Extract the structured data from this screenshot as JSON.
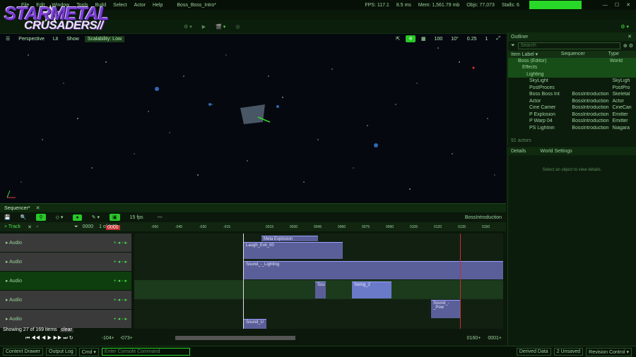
{
  "menubar": {
    "items": [
      "File",
      "Edit",
      "Window",
      "Tools",
      "Build",
      "Select",
      "Actor",
      "Help"
    ],
    "tab": "Boss_Boss_Intro*"
  },
  "logo": {
    "line1": "STARMETAL",
    "line2": "CRUSADERS//"
  },
  "stats": {
    "fps": "FPS: 117.1",
    "ms": "8.5 ms",
    "mem": "Mem: 1,561.79 mb",
    "objs": "Objs: 77,073",
    "stalls": "Stalls: 6"
  },
  "viewport": {
    "perspective": "Perspective",
    "lit": "Lit",
    "show": "Show",
    "scalability": "Scalability: Low",
    "grid": "100",
    "rot": "10°",
    "scale": "0.25",
    "cam": "1",
    "axis": "Y"
  },
  "outliner": {
    "tab": "Outliner",
    "search_placeholder": "Search",
    "col1": "Item Label ▾",
    "col2": "Sequencer",
    "col3": "Type",
    "rows": [
      {
        "c1": "Boss (Editor)",
        "c2": "",
        "c3": "World"
      },
      {
        "c1": "Effects",
        "c2": "",
        "c3": ""
      },
      {
        "c1": "Lighting",
        "c2": "",
        "c3": ""
      },
      {
        "c1": "SkyLight",
        "c2": "",
        "c3": "SkyLigh"
      },
      {
        "c1": "PostProces",
        "c2": "",
        "c3": "PostPro"
      },
      {
        "c1": "Boss Boss Int",
        "c2": "BossIntroduction",
        "c3": "Skeletal"
      },
      {
        "c1": "Actor",
        "c2": "BossIntroduction",
        "c3": "Actor"
      },
      {
        "c1": "Cine Camer",
        "c2": "BossIntroduction",
        "c3": "CineCan"
      },
      {
        "c1": "P Explosion",
        "c2": "BossIntroduction",
        "c3": "Emitter"
      },
      {
        "c1": "P Warp 04",
        "c2": "BossIntroduction",
        "c3": "Emitter"
      },
      {
        "c1": "PS Lightnin",
        "c2": "BossIntroduction",
        "c3": "Niagara"
      }
    ],
    "count": "91 actors"
  },
  "details": {
    "tab1": "Details",
    "tab2": "World Settings",
    "empty": "Select an object to view details."
  },
  "sequencer": {
    "tab": "Sequencer*",
    "fps": "15 fps",
    "name": "BossIntroduction",
    "track_btn": "+ Track",
    "filter": "Filter",
    "frame": "0000",
    "range": "1 of 140",
    "playhead": "0000",
    "ticks": [
      "-060",
      "-045",
      "-030",
      "-015",
      "0015",
      "0030",
      "0045",
      "0060",
      "0075",
      "0090",
      "0105",
      "0120",
      "0135",
      "0150"
    ],
    "tracks": [
      {
        "label": "Audio",
        "highlight": false
      },
      {
        "label": "Audio",
        "highlight": false
      },
      {
        "label": "Audio",
        "highlight": true
      },
      {
        "label": "Audio",
        "highlight": false
      },
      {
        "label": "Audio",
        "highlight": false
      }
    ],
    "clips": [
      "Meta Explosion",
      "Laugh_Evil_00",
      "Sound_-_Lighting",
      "Sou",
      "Swing_2",
      "Sound_-_Pow",
      "Sound_U"
    ],
    "showing": "Showing 27 of 169 items",
    "clear": "clear",
    "range_left": "-104+",
    "range_left2": "-073+",
    "range_right": "0160+",
    "range_right2": "0001+"
  },
  "statusbar": {
    "content": "Content Drawer",
    "log": "Output Log",
    "cmd": "Cmd ▾",
    "console_placeholder": "Enter Console Command",
    "derived": "Derived Data",
    "unsaved": "2 Unsaved",
    "revision": "Revision Control ▾"
  }
}
